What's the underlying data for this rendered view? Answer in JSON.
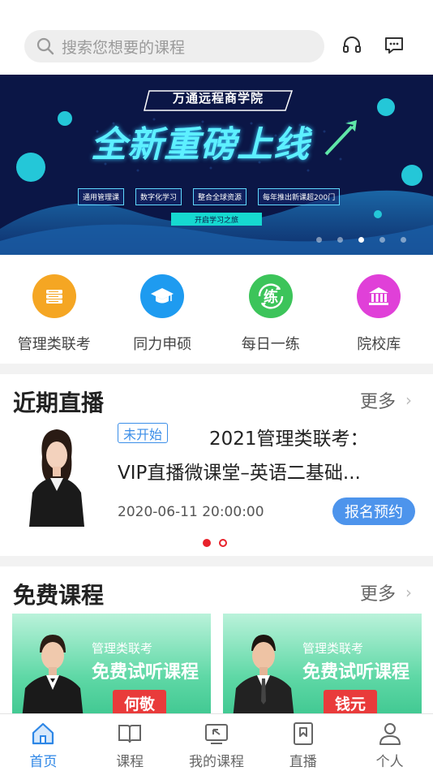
{
  "search": {
    "placeholder": "搜索您想要的课程"
  },
  "header": {
    "icons": [
      "headset-icon",
      "message-icon"
    ]
  },
  "banner": {
    "school": "万通远程商学院",
    "headline": "全新重磅上线",
    "tags": [
      "通用管理课",
      "数字化学习",
      "整合全球资源",
      "每年推出新课超200门"
    ],
    "cta": "开启学习之旅",
    "slides_total": 5,
    "active_slide": 3
  },
  "quick_nav": [
    {
      "label": "管理类联考",
      "icon": "book-stack-icon",
      "color": "#f5a623"
    },
    {
      "label": "同力申硕",
      "icon": "graduation-cap-icon",
      "color": "#1e9bf0"
    },
    {
      "label": "每日一练",
      "icon": "practice-icon",
      "color": "#3cc45a",
      "glyph": "练"
    },
    {
      "label": "院校库",
      "icon": "university-icon",
      "color": "#e040d8"
    }
  ],
  "live": {
    "title": "近期直播",
    "more": "更多",
    "item": {
      "status": "未开始",
      "title_line1": "2021管理类联考：",
      "title_line2": "VIP直播微课堂–英语二基础...",
      "time": "2020-06-11 20:00:00",
      "action": "报名预约"
    },
    "pages": 2,
    "current_page": 1
  },
  "free": {
    "title": "免费课程",
    "more": "更多",
    "cards": [
      {
        "type": "管理类联考",
        "title": "免费试听课程",
        "teacher": "何敬"
      },
      {
        "type": "管理类联考",
        "title": "免费试听课程",
        "teacher": "钱元"
      }
    ]
  },
  "tabbar": [
    {
      "label": "首页",
      "icon": "home-icon",
      "active": true
    },
    {
      "label": "课程",
      "icon": "open-book-icon",
      "active": false
    },
    {
      "label": "我的课程",
      "icon": "my-course-icon",
      "active": false
    },
    {
      "label": "直播",
      "icon": "live-icon",
      "active": false
    },
    {
      "label": "个人",
      "icon": "person-icon",
      "active": false
    }
  ],
  "colors": {
    "accent": "#2d86e6",
    "live_badge": "#3b8ee8",
    "reserve": "#4d94ec",
    "pager": "#e8222b"
  }
}
